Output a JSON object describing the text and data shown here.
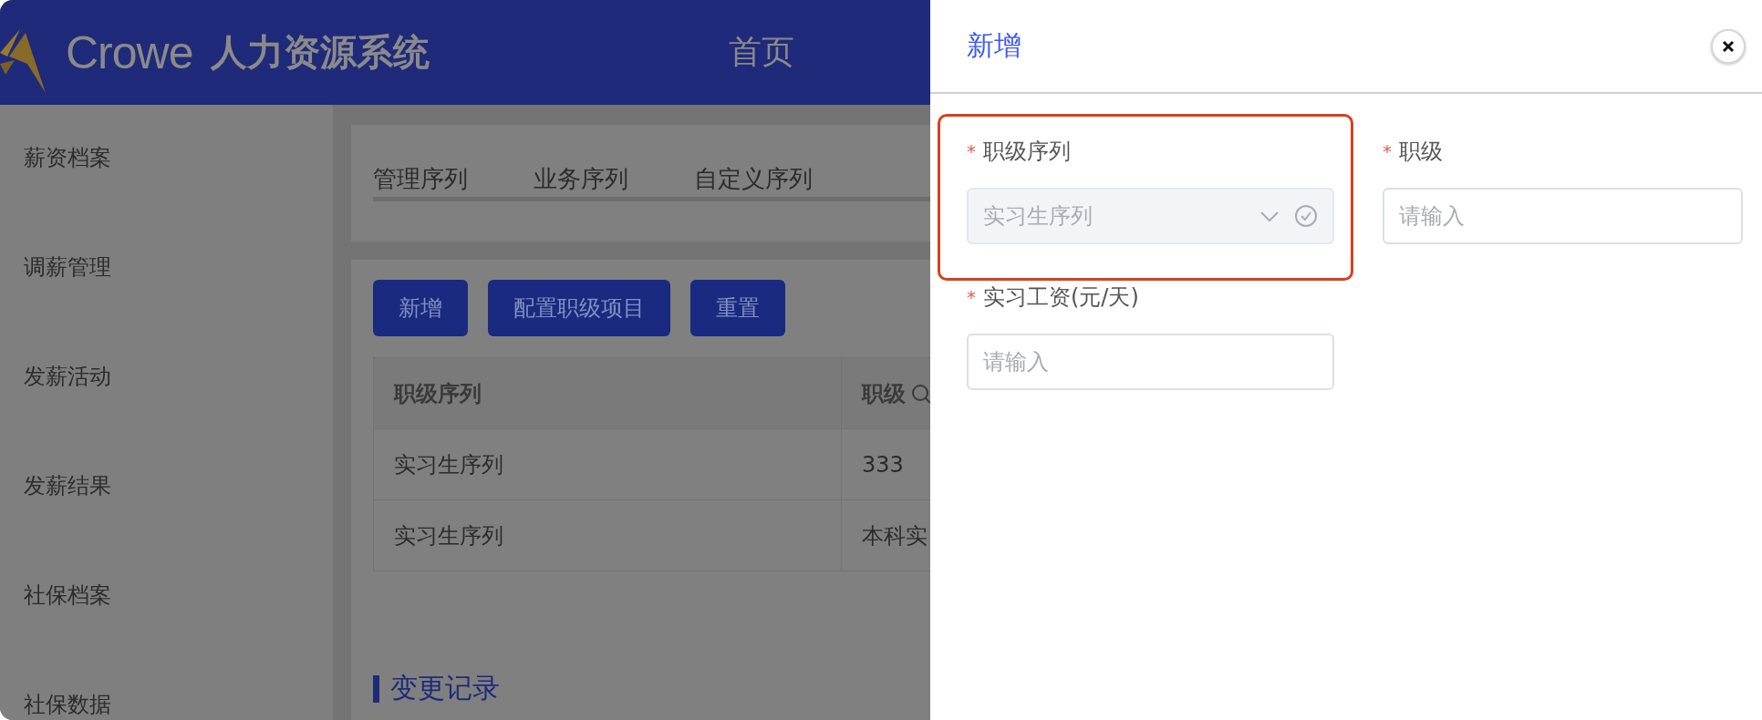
{
  "header": {
    "brand": "Crowe",
    "title": "人力资源系统",
    "nav": [
      {
        "label": "首页"
      }
    ]
  },
  "sidebar": {
    "items": [
      {
        "label": "薪资档案"
      },
      {
        "label": "调薪管理"
      },
      {
        "label": "发薪活动"
      },
      {
        "label": "发薪结果"
      },
      {
        "label": "社保档案"
      },
      {
        "label": "社保数据"
      }
    ]
  },
  "tabs": [
    {
      "label": "管理序列",
      "selected": false
    },
    {
      "label": "业务序列",
      "selected": false
    },
    {
      "label": "自定义序列",
      "selected": false
    }
  ],
  "toolbar": {
    "buttons": [
      "新增",
      "配置职级项目",
      "重置"
    ]
  },
  "table": {
    "columns": [
      {
        "label": "职级序列",
        "search": false
      },
      {
        "label": "职级",
        "search": true
      }
    ],
    "rows": [
      [
        "实习生序列",
        "333"
      ],
      [
        "实习生序列",
        "本科实"
      ]
    ]
  },
  "section_title": "变更记录",
  "drawer": {
    "title": "新增",
    "fields": [
      {
        "label": "职级序列",
        "required_mark": "*",
        "kind": "select",
        "value": "实习生序列",
        "disabled": true,
        "highlighted": true
      },
      {
        "label": "职级",
        "required_mark": "*",
        "kind": "input",
        "placeholder": "请输入",
        "highlighted": false
      },
      {
        "label": "实习工资(元/天)",
        "required_mark": "*",
        "kind": "input",
        "placeholder": "请输入",
        "highlighted": false
      }
    ]
  }
}
